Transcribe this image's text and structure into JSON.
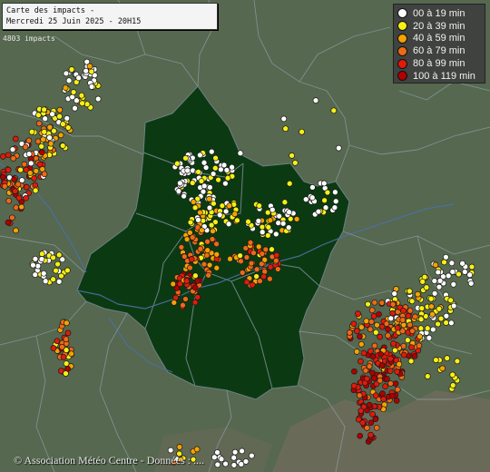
{
  "title": {
    "line1": "Carte des impacts -",
    "line2": "Mercredi 25 Juin 2025 - 20H15"
  },
  "impact_count": "4803 impacts",
  "legend": [
    {
      "label": "00 à 19 min",
      "color": "#ffffff"
    },
    {
      "label": "20 à 39 min",
      "color": "#f6f013"
    },
    {
      "label": "40 à 59 min",
      "color": "#f5a200"
    },
    {
      "label": "60 à 79 min",
      "color": "#ee6a14"
    },
    {
      "label": "80 à 99 min",
      "color": "#e21a0a"
    },
    {
      "label": "100 à 119 min",
      "color": "#b00000"
    }
  ],
  "credit": "© Association Météo Centre - Données : ....",
  "colors": {
    "background": "#56684f",
    "region_fill": "#0b3a12",
    "borders": "#8a9aa0",
    "rivers": "#4d6fa6"
  }
}
